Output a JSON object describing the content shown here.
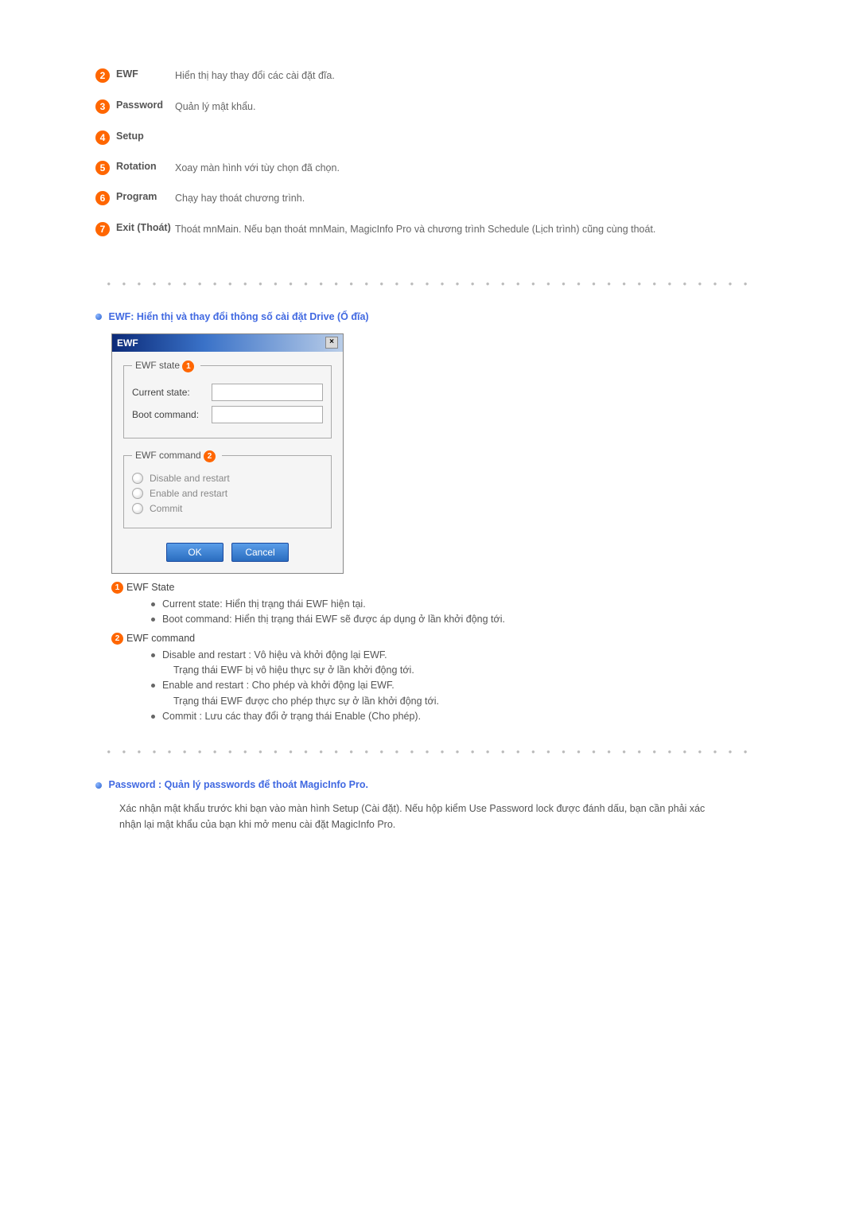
{
  "menu": {
    "items": [
      {
        "num": "2",
        "label": "EWF",
        "desc": "Hiển thị hay thay đổi các cài đặt đĩa."
      },
      {
        "num": "3",
        "label": "Password",
        "desc": "Quản lý mật khẩu."
      },
      {
        "num": "4",
        "label": "Setup",
        "desc": ""
      },
      {
        "num": "5",
        "label": "Rotation",
        "desc": "Xoay màn hình với tùy chọn đã chọn."
      },
      {
        "num": "6",
        "label": "Program",
        "desc": "Chạy hay thoát chương trình."
      },
      {
        "num": "7",
        "label": "Exit (Thoát)",
        "desc": "Thoát mnMain. Nếu bạn thoát mnMain, MagicInfo Pro và chương trình Schedule (Lịch trình) cũng cùng thoát."
      }
    ]
  },
  "ewf_section": {
    "heading": "EWF: Hiển thị và thay đổi thông số cài đặt Drive (Ổ đĩa)",
    "dialog": {
      "title": "EWF",
      "close": "×",
      "fieldset_state": {
        "legend_prefix": "EWF state",
        "legend_num": "1",
        "rows": [
          {
            "label": "Current state:"
          },
          {
            "label": "Boot command:"
          }
        ]
      },
      "fieldset_cmd": {
        "legend_prefix": "EWF command",
        "legend_num": "2",
        "radios": [
          "Disable and restart",
          "Enable and restart",
          "Commit"
        ]
      },
      "ok": "OK",
      "cancel": "Cancel"
    },
    "explain_state": {
      "num": "1",
      "title": "EWF State",
      "items": [
        "Current state: Hiển thị trạng thái EWF hiện tại.",
        "Boot command: Hiển thị trạng thái EWF sẽ được áp dụng ở lần khởi động tới."
      ]
    },
    "explain_cmd": {
      "num": "2",
      "title": "EWF command",
      "items_a": "Disable and restart : Vô hiệu và khởi động lại EWF.",
      "items_a_sub": "Trạng thái EWF bị vô hiệu thực sự ở lần khởi động tới.",
      "items_b": "Enable and restart : Cho phép và khởi động lại EWF.",
      "items_b_sub": "Trạng thái EWF được cho phép thực sự ở lần khởi động tới.",
      "items_c": "Commit : Lưu các thay đổi ở trạng thái Enable (Cho phép)."
    }
  },
  "password_section": {
    "heading": "Password : Quản lý passwords để thoát MagicInfo Pro.",
    "desc": "Xác nhận mật khẩu trước khi bạn vào màn hình Setup (Cài đặt). Nếu hộp kiểm Use Password lock được đánh dấu, bạn cần phải xác nhận lại mật khẩu của bạn khi mở menu cài đặt MagicInfo Pro."
  },
  "dots": "● ● ● ● ● ● ● ● ● ● ● ● ● ● ● ● ● ● ● ● ● ● ● ● ● ● ● ● ● ● ● ● ● ● ● ● ● ● ● ● ● ● ●"
}
